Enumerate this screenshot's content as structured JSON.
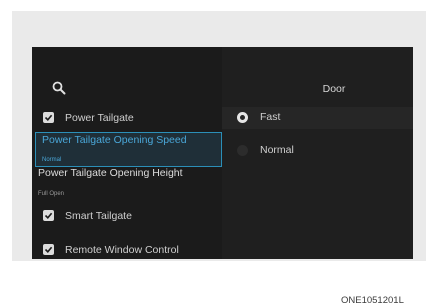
{
  "menu": {
    "items": [
      {
        "label": "Power Tailgate",
        "checked": true
      },
      {
        "label": "Power Tailgate Opening Speed",
        "sub": "Normal",
        "selected": true
      },
      {
        "label": "Power Tailgate Opening Height",
        "sub": "Full Open"
      },
      {
        "label": "Smart Tailgate",
        "checked": true
      },
      {
        "label": "Remote Window Control",
        "checked": true
      }
    ]
  },
  "panel": {
    "title": "Door",
    "options": [
      {
        "label": "Fast",
        "selected": true
      },
      {
        "label": "Normal",
        "selected": false
      }
    ]
  },
  "caption": "ONE1051201L",
  "colors": {
    "accent": "#2b8fb8",
    "screen_bg": "#141414"
  }
}
